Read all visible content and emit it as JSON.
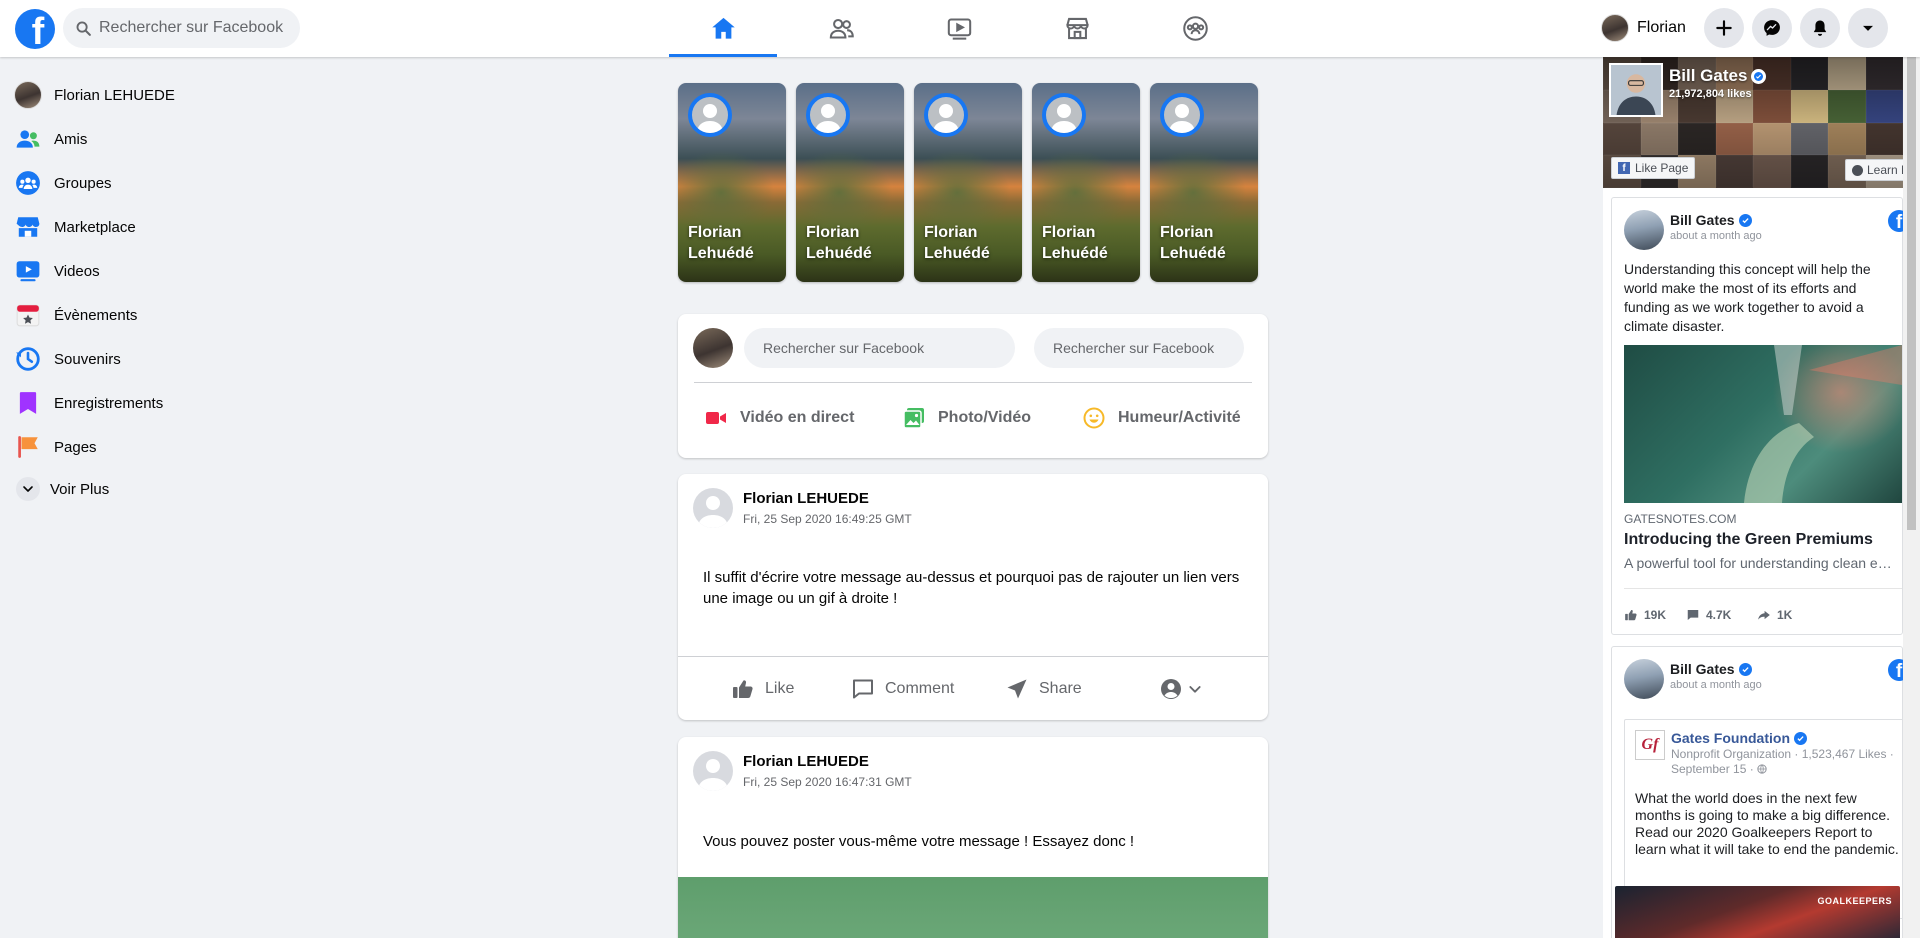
{
  "header": {
    "search_placeholder": "Rechercher sur Facebook",
    "nav_tabs": [
      {
        "name": "home",
        "active": true
      },
      {
        "name": "friends",
        "active": false
      },
      {
        "name": "watch",
        "active": false
      },
      {
        "name": "marketplace",
        "active": false
      },
      {
        "name": "groups",
        "active": false
      }
    ],
    "profile_name": "Florian",
    "accent": "#1877f2"
  },
  "sidebar": {
    "items": [
      {
        "label": "Florian LEHUEDE",
        "icon": "profile-avatar"
      },
      {
        "label": "Amis",
        "icon": "friends-icon"
      },
      {
        "label": "Groupes",
        "icon": "groups-icon"
      },
      {
        "label": "Marketplace",
        "icon": "marketplace-icon"
      },
      {
        "label": "Videos",
        "icon": "videos-icon"
      },
      {
        "label": "Évènements",
        "icon": "events-icon"
      },
      {
        "label": "Souvenirs",
        "icon": "memories-icon"
      },
      {
        "label": "Enregistrements",
        "icon": "saved-icon"
      },
      {
        "label": "Pages",
        "icon": "pages-flag-icon"
      }
    ],
    "see_more": "Voir Plus"
  },
  "stories": [
    {
      "line1": "Florian",
      "line2": "Lehuédé"
    },
    {
      "line1": "Florian",
      "line2": "Lehuédé"
    },
    {
      "line1": "Florian",
      "line2": "Lehuédé"
    },
    {
      "line1": "Florian",
      "line2": "Lehuédé"
    },
    {
      "line1": "Florian",
      "line2": "Lehuédé"
    }
  ],
  "composer": {
    "input1_placeholder": "Rechercher sur Facebook",
    "input2_placeholder": "Rechercher sur Facebook",
    "live_label": "Vidéo en direct",
    "photo_label": "Photo/Vidéo",
    "feeling_label": "Humeur/Activité"
  },
  "posts": [
    {
      "author": "Florian LEHUEDE",
      "date": "Fri, 25 Sep 2020 16:49:25 GMT",
      "text": "Il suffit d'écrire votre message au-dessus et pourquoi pas de rajouter un lien vers une image ou un gif à droite !",
      "like": "Like",
      "comment": "Comment",
      "share": "Share"
    },
    {
      "author": "Florian LEHUEDE",
      "date": "Fri, 25 Sep 2020 16:47:31 GMT",
      "text": "Vous pouvez poster vous-même votre message ! Essayez donc !"
    }
  ],
  "right": {
    "page": {
      "name": "Bill Gates",
      "likes": "21,972,804 likes",
      "like_button": "Like Page",
      "learn_button": "Learn M"
    },
    "ad1": {
      "name": "Bill Gates",
      "time": "about a month ago",
      "body": "Understanding this concept will help the world make the most of its efforts and funding as we work together to avoid a climate disaster.",
      "domain": "GATESNOTES.COM",
      "headline": "Introducing the Green Premiums",
      "description": "A powerful tool for understanding clean en...",
      "likes": "19K",
      "comments": "4.7K",
      "shares": "1K"
    },
    "ad2": {
      "name": "Bill Gates",
      "time": "about a month ago",
      "shared_page": "Gates Foundation",
      "shared_meta": "Nonprofit Organization · 1,523,467 Likes · September 15 ·",
      "body": "What the world does in the next few months is going to make a big difference. Read our 2020 Goalkeepers Report to learn what it will take to end the pandemic.",
      "image_tag": "GOALKEEPERS"
    }
  }
}
